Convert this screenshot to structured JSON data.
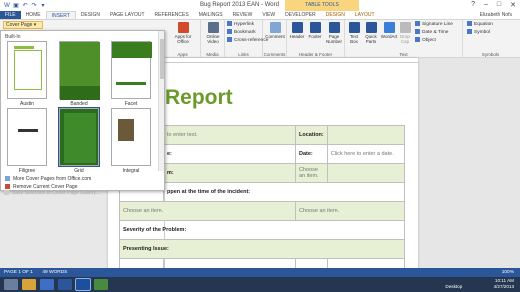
{
  "window": {
    "title": "Bug Report 2013 EAN - Word",
    "context_tab_group": "TABLE TOOLS",
    "controls": [
      "?",
      "–",
      "□",
      "✕"
    ]
  },
  "tabs": [
    "FILE",
    "HOME",
    "INSERT",
    "DESIGN",
    "PAGE LAYOUT",
    "REFERENCES",
    "MAILINGS",
    "REVIEW",
    "VIEW",
    "DEVELOPER",
    "DESIGN",
    "LAYOUT"
  ],
  "user": "Elizabeth Nofs",
  "ribbon": {
    "cover_page_label": "Cover Page",
    "apps": {
      "label": "Apps for Office",
      "group": "Apps"
    },
    "media": {
      "label": "Online Video",
      "group": "Media"
    },
    "links": {
      "items": [
        "Hyperlink",
        "Bookmark",
        "Cross-reference"
      ],
      "group": "Links"
    },
    "comments": {
      "label": "Comment",
      "group": "Comments"
    },
    "header_footer": {
      "items": [
        "Header",
        "Footer",
        "Page Number"
      ],
      "group": "Header & Footer"
    },
    "text": {
      "items": [
        "Text Box",
        "Quick Parts",
        "WordArt",
        "Drop Cap"
      ],
      "side": [
        "Signature Line",
        "Date & Time",
        "Object"
      ],
      "group": "Text"
    },
    "symbols": {
      "items": [
        "Equation",
        "Symbol"
      ],
      "group": "Symbols"
    }
  },
  "dropdown": {
    "heading": "Built-In",
    "thumbs": [
      "Austin",
      "Banded",
      "Facet",
      "Filigree",
      "Grid",
      "Integral"
    ],
    "menu": [
      "More Cover Pages from Office.com",
      "Remove Current Cover Page",
      "Save Selection to Cover Page Gallery..."
    ]
  },
  "document": {
    "title": "Report",
    "rows": [
      [
        "",
        "to enter text.",
        "Location:",
        ""
      ],
      [
        "",
        "e:",
        "Date:",
        "Click here to enter a date."
      ],
      [
        "",
        "m:",
        "Choose an item.",
        ""
      ],
      [
        "",
        "ppen at the time of the incident:",
        "",
        ""
      ],
      [
        "Choose an item.",
        "",
        "Choose an item.",
        ""
      ],
      [
        "Severity of the Problem:",
        "",
        "",
        ""
      ],
      [
        "Presenting Issue:",
        "",
        "",
        ""
      ],
      [
        "",
        "",
        "",
        ""
      ]
    ]
  },
  "status": {
    "page": "PAGE 1 OF 1",
    "words": "49 WORDS",
    "zoom": "100%"
  },
  "taskbar": {
    "desktop_label": "Desktop",
    "time": "10:11 AM",
    "date": "4/27/2013"
  },
  "colors": {
    "accent": "#2b579a",
    "report_title": "#6a9b2a",
    "table_band": "#e7f0d4",
    "taskbar": "#253750"
  }
}
